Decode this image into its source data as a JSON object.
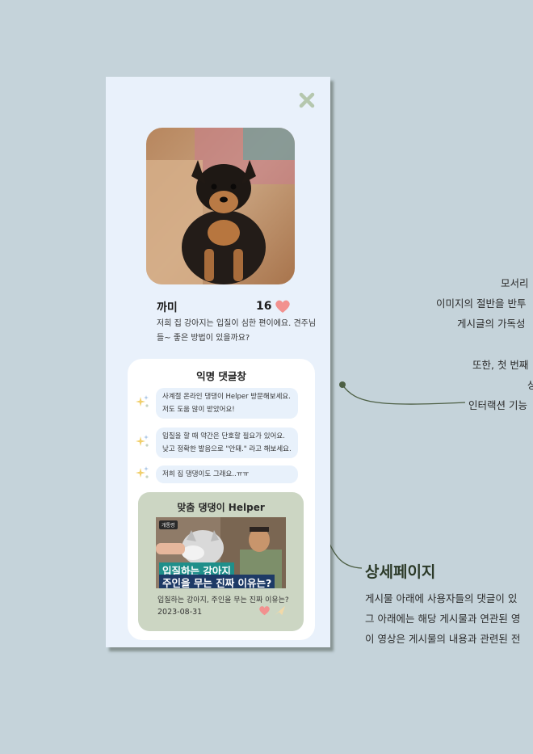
{
  "post": {
    "title": "까미",
    "likes": "16",
    "body": "저희 집 강아지는 입질이 심한 편이에요. 견주님들~ 좋은 방법이 있을까요?"
  },
  "comments": {
    "title": "익명 댓글창",
    "items": [
      "사계절 온라인 댕댕이 Helper 방문해보세요.\n저도 도움 많이 받았어요!",
      "입질을 할 때 약간은 단호할 필요가 있어요.\n낮고 정확한 발음으로 \"안돼.\" 라고 해보세요.",
      "저희 집 댕댕이도 그래요..ㅠㅠ"
    ]
  },
  "helper": {
    "title": "맞춤 댕댕이 Helper",
    "video_channel": "개통령",
    "video_overlay_line1": "입질하는 강아지",
    "video_overlay_line2": "주인을 무는 진짜 이유는?",
    "video_caption": "입질하는 강아지, 주인을 무는 진짜 이유는?",
    "video_date": "2023-08-31"
  },
  "annotations": {
    "a1": "모서리",
    "a2": "이미지의 절반을 반투",
    "a3": "게시글의 가독성",
    "b1": "또한, 첫 번째",
    "b2": "상",
    "b3": "인터랙션 기능",
    "heading": "상세페이지",
    "c1": "게시물 아래에 사용자들의 댓글이 있",
    "c2": "그 아래에는 해당 게시물과 연관된 영",
    "c3": "이 영상은 게시물의 내용과 관련된 전"
  },
  "colors": {
    "background": "#c5d3da",
    "phone": "#e9f1fb",
    "helper_card": "#ccd6c3",
    "heart": "#f28e8e",
    "accent_green": "#4d5f44"
  }
}
